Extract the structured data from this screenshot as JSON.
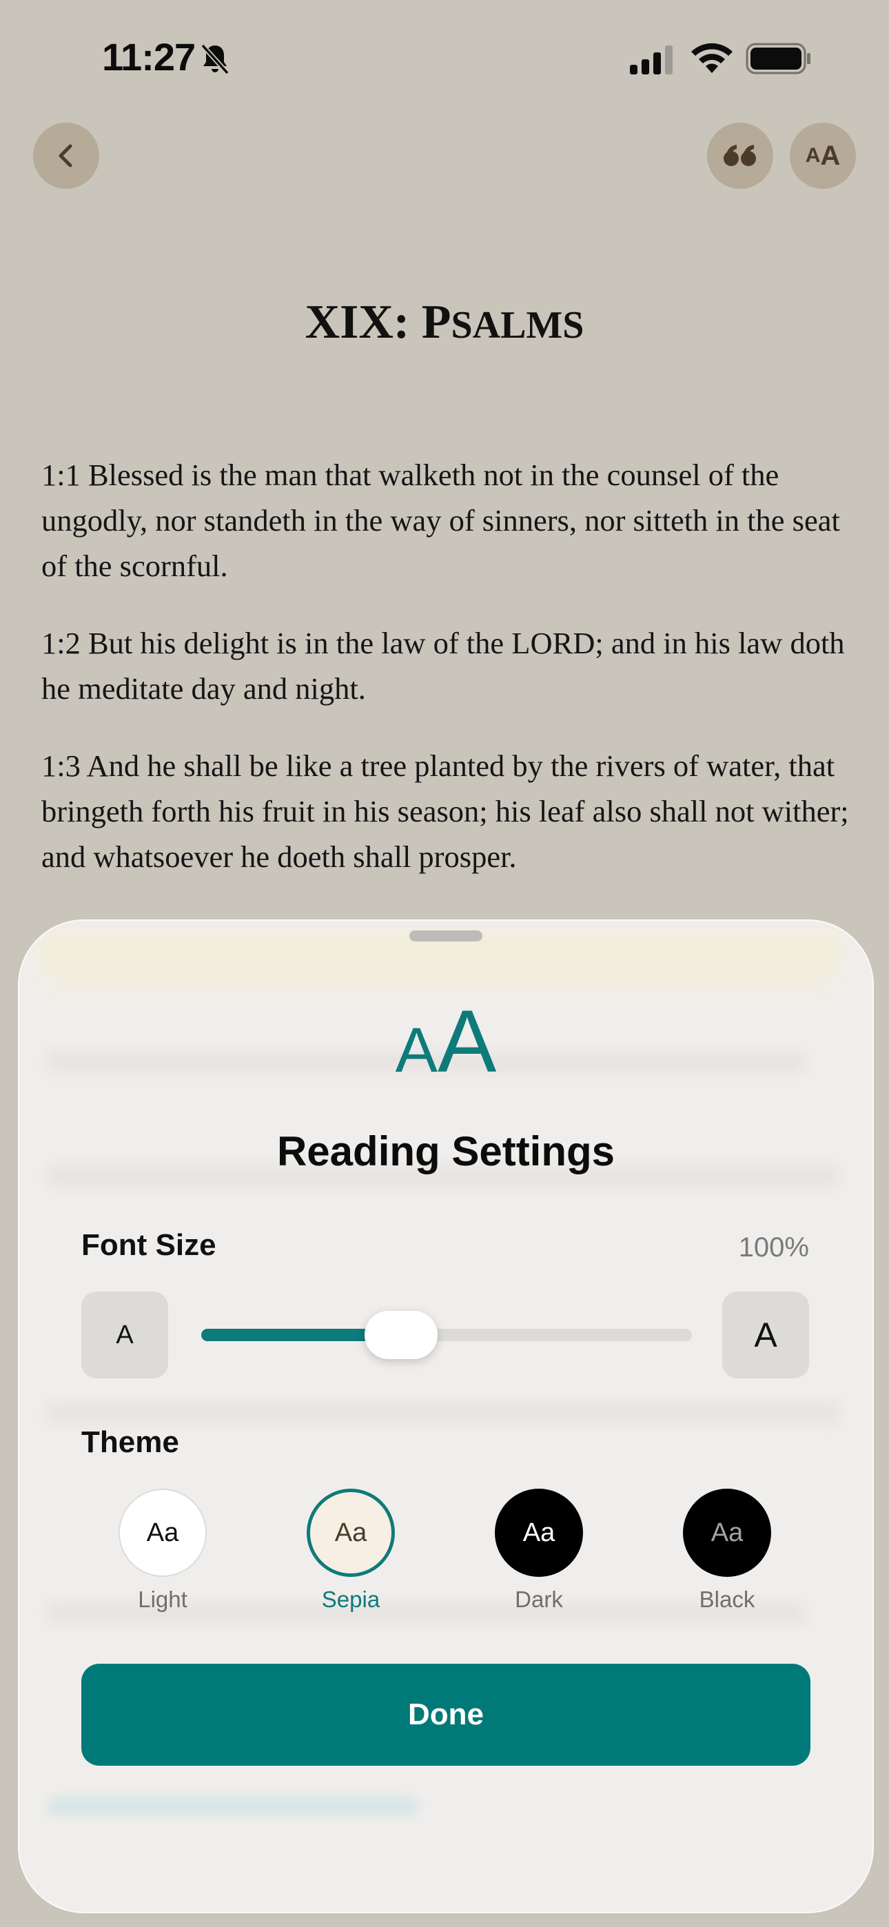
{
  "status_bar": {
    "time": "11:27"
  },
  "reader": {
    "title_roman": "XIX: ",
    "title_book": "Psalms",
    "verses": [
      "1:1 Blessed is the man that walketh not in the counsel of the ungodly, nor standeth in the way of sinners, nor sitteth in the seat of the scornful.",
      "1:2 But his delight is in the law of the LORD; and in his law doth he meditate day and night.",
      "1:3 And he shall be like a tree planted by the rivers of water, that bringeth forth his fruit in his season; his leaf also shall not wither; and whatsoever he doeth shall prosper."
    ]
  },
  "nav": {
    "text_size_glyph_small": "A",
    "text_size_glyph_large": "A"
  },
  "settings": {
    "icon_small": "A",
    "icon_large": "A",
    "title": "Reading Settings",
    "font_size_label": "Font Size",
    "font_size_value": "100%",
    "font_size_fraction": 0.39,
    "decrease_label": "A",
    "increase_label": "A",
    "theme_label": "Theme",
    "themes": [
      {
        "sample": "Aa",
        "name": "Light"
      },
      {
        "sample": "Aa",
        "name": "Sepia"
      },
      {
        "sample": "Aa",
        "name": "Dark"
      },
      {
        "sample": "Aa",
        "name": "Black"
      }
    ],
    "selected_theme": "Sepia",
    "done_label": "Done"
  },
  "colors": {
    "accent": "#007a78",
    "page_bg": "#c9c5bb",
    "nav_button": "#b6aa98"
  }
}
